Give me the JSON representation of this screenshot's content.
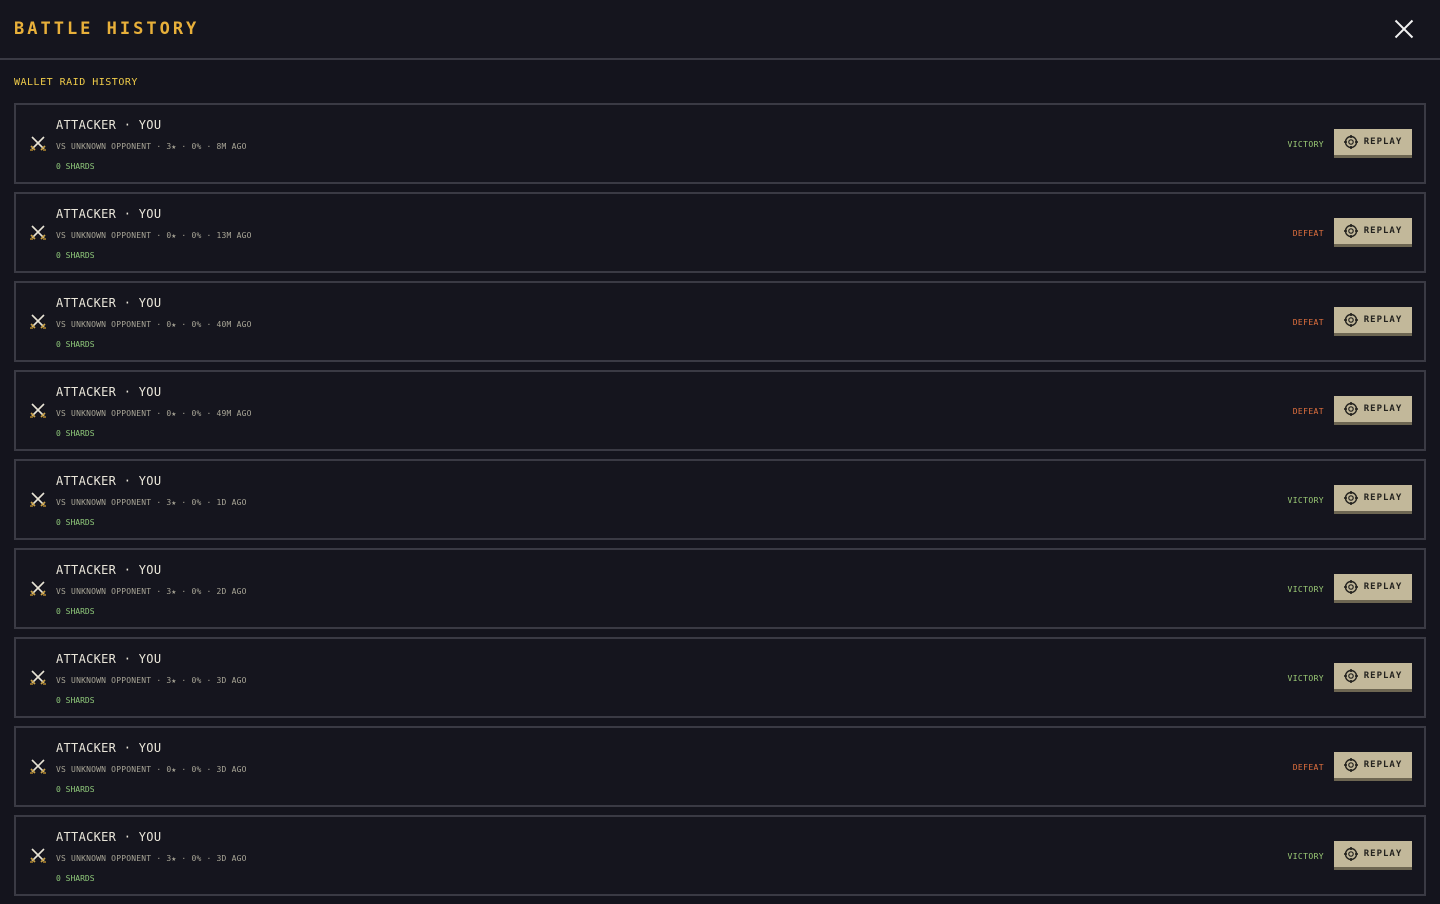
{
  "header": {
    "title": "BATTLE HISTORY",
    "close_icon": "close-icon"
  },
  "section": {
    "label": "WALLET RAID HISTORY"
  },
  "colors": {
    "victory": "#9ccc76",
    "defeat": "#e0703e",
    "accent": "#e8b03a"
  },
  "battles": [
    {
      "role": "ATTACKER · YOU",
      "details": "VS UNKNOWN OPPONENT · 3★ · 0% · 8M AGO",
      "shards": "0 SHARDS",
      "result": "VICTORY",
      "outcome": "victory",
      "replay": "REPLAY"
    },
    {
      "role": "ATTACKER · YOU",
      "details": "VS UNKNOWN OPPONENT · 0★ · 0% · 13M AGO",
      "shards": "0 SHARDS",
      "result": "DEFEAT",
      "outcome": "defeat",
      "replay": "REPLAY"
    },
    {
      "role": "ATTACKER · YOU",
      "details": "VS UNKNOWN OPPONENT · 0★ · 0% · 40M AGO",
      "shards": "0 SHARDS",
      "result": "DEFEAT",
      "outcome": "defeat",
      "replay": "REPLAY"
    },
    {
      "role": "ATTACKER · YOU",
      "details": "VS UNKNOWN OPPONENT · 0★ · 0% · 49M AGO",
      "shards": "0 SHARDS",
      "result": "DEFEAT",
      "outcome": "defeat",
      "replay": "REPLAY"
    },
    {
      "role": "ATTACKER · YOU",
      "details": "VS UNKNOWN OPPONENT · 3★ · 0% · 1D AGO",
      "shards": "0 SHARDS",
      "result": "VICTORY",
      "outcome": "victory",
      "replay": "REPLAY"
    },
    {
      "role": "ATTACKER · YOU",
      "details": "VS UNKNOWN OPPONENT · 3★ · 0% · 2D AGO",
      "shards": "0 SHARDS",
      "result": "VICTORY",
      "outcome": "victory",
      "replay": "REPLAY"
    },
    {
      "role": "ATTACKER · YOU",
      "details": "VS UNKNOWN OPPONENT · 3★ · 0% · 3D AGO",
      "shards": "0 SHARDS",
      "result": "VICTORY",
      "outcome": "victory",
      "replay": "REPLAY"
    },
    {
      "role": "ATTACKER · YOU",
      "details": "VS UNKNOWN OPPONENT · 0★ · 0% · 3D AGO",
      "shards": "0 SHARDS",
      "result": "DEFEAT",
      "outcome": "defeat",
      "replay": "REPLAY"
    },
    {
      "role": "ATTACKER · YOU",
      "details": "VS UNKNOWN OPPONENT · 3★ · 0% · 3D AGO",
      "shards": "0 SHARDS",
      "result": "VICTORY",
      "outcome": "victory",
      "replay": "REPLAY"
    }
  ]
}
